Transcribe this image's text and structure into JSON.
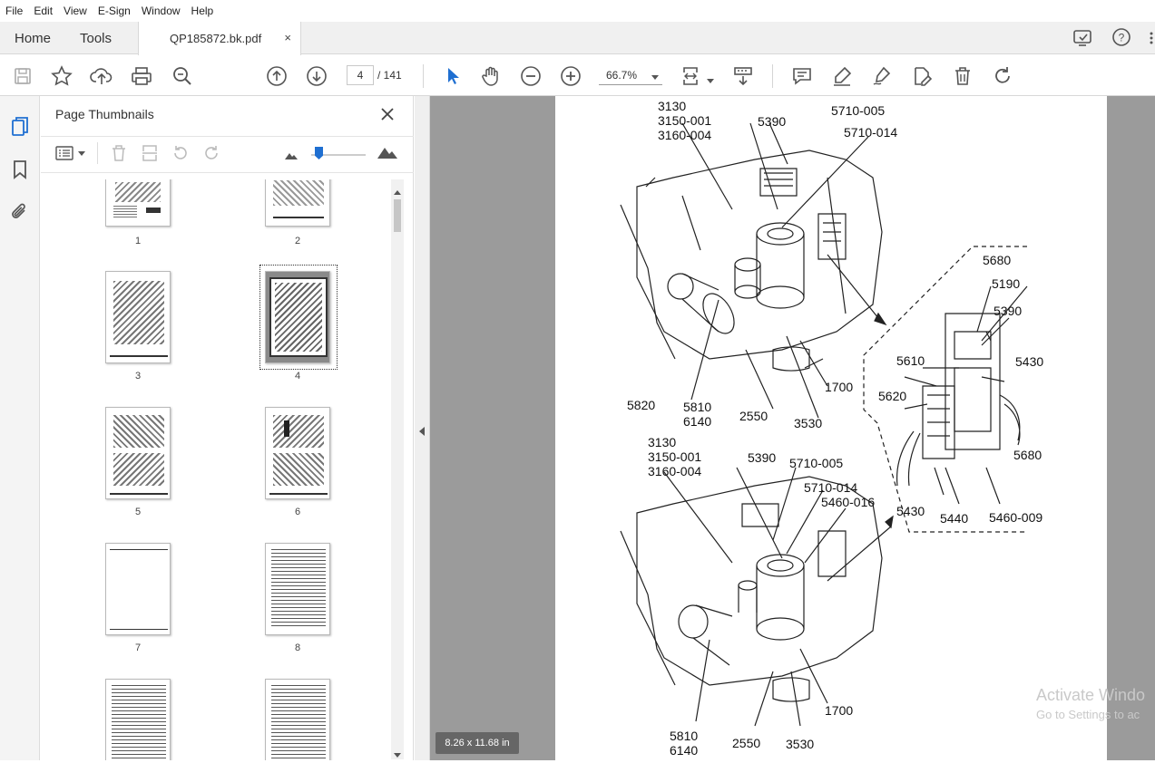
{
  "menu": [
    "File",
    "Edit",
    "View",
    "E-Sign",
    "Window",
    "Help"
  ],
  "tabs": {
    "home": "Home",
    "tools": "Tools",
    "document": "QP185872.bk.pdf",
    "close": "×"
  },
  "toolbar": {
    "page_current": "4",
    "page_total": "/ 141",
    "zoom": "66.7%"
  },
  "panel": {
    "title": "Page Thumbnails",
    "thumbnails": [
      "1",
      "2",
      "3",
      "4",
      "5",
      "6",
      "7",
      "8"
    ]
  },
  "viewer": {
    "page_size": "8.26 x 11.68 in",
    "callouts_top": {
      "c1": "3130\n3150-001\n3160-004",
      "c2": "5390",
      "c3": "5710-005",
      "c4": "5710-014",
      "c5": "5820",
      "c6": "5810\n6140",
      "c7": "2550",
      "c8": "3530",
      "c9": "1700"
    },
    "callouts_detail": {
      "d1": "5680",
      "d2": "5190",
      "d3": "5390",
      "d4": "5610",
      "d5": "5430",
      "d6": "5620",
      "d7": "5680",
      "d8": "5430",
      "d9": "5440",
      "d10": "5460-009"
    },
    "callouts_bottom": {
      "b1": "3130\n3150-001\n3160-004",
      "b2": "5390",
      "b3": "5710-005",
      "b4": "5710-014",
      "b5": "5460-016",
      "b6": "1700",
      "b7": "5810\n6140",
      "b8": "2550",
      "b9": "3530"
    },
    "watermark_line1": "Activate Windo",
    "watermark_line2": "Go to Settings to ac"
  }
}
